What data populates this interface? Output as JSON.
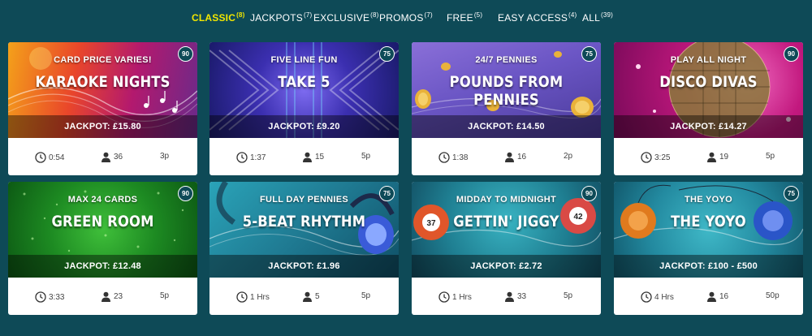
{
  "tabs": [
    {
      "label": "CLASSIC",
      "count": "(8)",
      "active": true
    },
    {
      "label": "JACKPOTS",
      "count": "(7)",
      "active": false
    },
    {
      "label": "EXCLUSIVE",
      "count": "(8)",
      "active": false
    },
    {
      "label": "PROMOS",
      "count": "(7)",
      "active": false
    },
    {
      "label": "FREE",
      "count": "(5)",
      "active": false
    },
    {
      "label": "EASY ACCESS",
      "count": "(4)",
      "active": false
    },
    {
      "label": "ALL",
      "count": "(39)",
      "active": false
    }
  ],
  "colors": {
    "background": "#0e4a57",
    "active_tab": "#f2e600"
  },
  "games": [
    {
      "tagline": "CARD PRICE VARIES!",
      "title": "KARAOKE NIGHTS",
      "jackpot": "JACKPOT: £15.80",
      "ratio": "90",
      "time": "0:54",
      "players": "36",
      "price": "3p",
      "theme": "karaoke"
    },
    {
      "tagline": "FIVE LINE FUN",
      "title": "TAKE 5",
      "jackpot": "JACKPOT: £9.20",
      "ratio": "75",
      "time": "1:37",
      "players": "15",
      "price": "5p",
      "theme": "take5"
    },
    {
      "tagline": "24/7 PENNIES",
      "title": "POUNDS FROM PENNIES",
      "jackpot": "JACKPOT: £14.50",
      "ratio": "75",
      "time": "1:38",
      "players": "16",
      "price": "2p",
      "theme": "pennies"
    },
    {
      "tagline": "PLAY ALL NIGHT",
      "title": "DISCO DIVAS",
      "jackpot": "JACKPOT: £14.27",
      "ratio": "90",
      "time": "3:25",
      "players": "19",
      "price": "5p",
      "theme": "disco"
    },
    {
      "tagline": "MAX 24 CARDS",
      "title": "GREEN ROOM",
      "jackpot": "JACKPOT: £12.48",
      "ratio": "90",
      "time": "3:33",
      "players": "23",
      "price": "5p",
      "theme": "green"
    },
    {
      "tagline": "FULL DAY PENNIES",
      "title": "5-BEAT RHYTHM",
      "jackpot": "JACKPOT: £1.96",
      "ratio": "75",
      "time": "1 Hrs",
      "players": "5",
      "price": "5p",
      "theme": "rhythm"
    },
    {
      "tagline": "MIDDAY TO MIDNIGHT",
      "title": "GETTIN' JIGGY",
      "jackpot": "JACKPOT: £2.72",
      "ratio": "90",
      "time": "1 Hrs",
      "players": "33",
      "price": "5p",
      "theme": "jiggy",
      "ball_numbers": [
        "37",
        "42"
      ]
    },
    {
      "tagline": "THE YOYO",
      "title": "THE YOYO",
      "jackpot": "JACKPOT: £100 - £500",
      "ratio": "75",
      "time": "4 Hrs",
      "players": "16",
      "price": "50p",
      "theme": "yoyo"
    }
  ]
}
